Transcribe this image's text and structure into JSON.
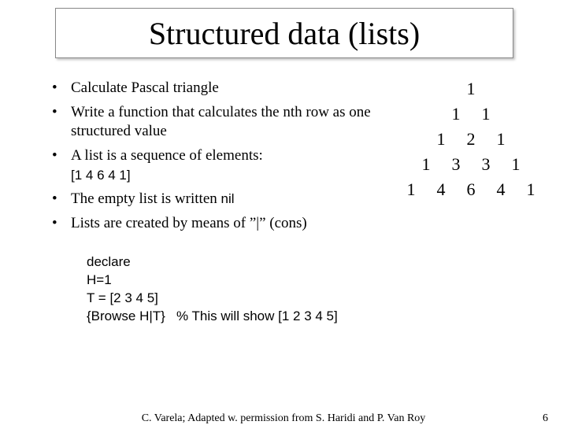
{
  "title": "Structured data (lists)",
  "bullets": {
    "b1": "Calculate Pascal triangle",
    "b2": "Write a function that calculates the nth row as one structured value",
    "b3a": "A list is a sequence of elements:",
    "b3b": "[1 4 6 4 1]",
    "b4a": "The empty list is written ",
    "b4b": "nil",
    "b5": "Lists are created by means of  ”|”  (cons)"
  },
  "code": {
    "l1": "declare",
    "l2": "H=1",
    "l3": "T = [2 3 4 5]",
    "l4": "{Browse H|T}   % This will show [1 2 3 4 5]"
  },
  "pascal": {
    "r1": [
      "1"
    ],
    "r2": [
      "1",
      "1"
    ],
    "r3": [
      "1",
      "2",
      "1"
    ],
    "r4": [
      "1",
      "3",
      "3",
      "1"
    ],
    "r5": [
      "1",
      "4",
      "6",
      "4",
      "1"
    ]
  },
  "footer": {
    "credit": "C. Varela;  Adapted w. permission from S. Haridi and P. Van Roy",
    "page": "6"
  }
}
